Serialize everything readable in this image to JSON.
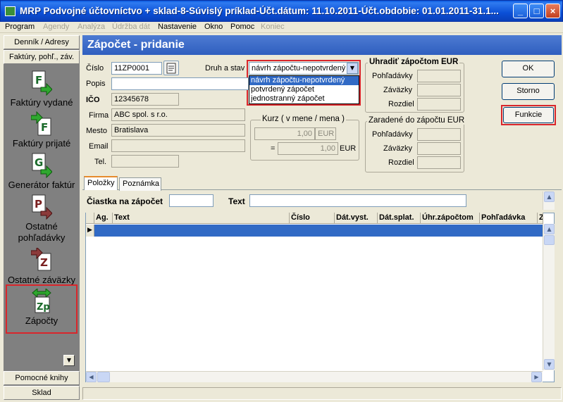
{
  "window": {
    "title": "MRP Podvojné účtovníctvo + sklad-8-Súvislý príklad-Účt.dátum: 11.10.2011-Účt.obdobie: 01.01.2011-31.1..."
  },
  "menu": [
    "Program",
    "Agendy",
    "Analýza",
    "Údržba dát",
    "Nastavenie",
    "Okno",
    "Pomoc",
    "Koniec"
  ],
  "sidebar": {
    "top_headers": [
      "Denník / Adresy",
      "Faktúry, pohľ., záv."
    ],
    "items": [
      {
        "label": "Faktúry vydané",
        "icon": "invoice-issued-icon"
      },
      {
        "label": "Faktúry prijaté",
        "icon": "invoice-received-icon"
      },
      {
        "label": "Generátor faktúr",
        "icon": "invoice-generator-icon"
      },
      {
        "label": "Ostatné pohľadávky",
        "icon": "receivables-icon"
      },
      {
        "label": "Ostatné záväzky",
        "icon": "liabilities-icon"
      },
      {
        "label": "Zápočty",
        "icon": "offset-icon"
      }
    ],
    "bottom_headers": [
      "Pomocné knihy",
      "Sklad"
    ]
  },
  "form": {
    "title": "Zápočet - pridanie",
    "cislo_label": "Číslo",
    "cislo_value": "11ZP0001",
    "druh_label": "Druh a stav",
    "druh_selected": "návrh zápočtu-nepotvrdený",
    "druh_options": [
      "návrh zápočtu-nepotvrdený",
      "potvrdený zápočet",
      "jednostranný zápočet"
    ],
    "popis_label": "Popis",
    "ico_label": "IČO",
    "ico_value": "12345678",
    "firma_label": "Firma",
    "firma_value": "ABC spol. s r.o.",
    "mesto_label": "Mesto",
    "mesto_value": "Bratislava",
    "email_label": "Email",
    "tel_label": "Tel.",
    "kurz_title": "Kurz ( v mene / mena )",
    "kurz_value": "1,00",
    "kurz_currency": "EUR",
    "kurz_eq": "=",
    "kurz_result": "1,00",
    "kurz_result_currency": "EUR",
    "uhradit_title": "Uhradiť zápočtom EUR",
    "zaradene_title": "Zaradené do zápočtu EUR",
    "pohladavky_label": "Pohľadávky",
    "zavazky_label": "Záväzky",
    "rozdiel_label": "Rozdiel"
  },
  "buttons": {
    "ok": "OK",
    "storno": "Storno",
    "funkcie": "Funkcie"
  },
  "tabs": [
    "Položky",
    "Poznámka"
  ],
  "filter": {
    "ciastka_label": "Čiastka na zápočet",
    "text_label": "Text"
  },
  "grid": {
    "columns": [
      "Ag.",
      "Text",
      "Číslo",
      "Dát.vyst.",
      "Dát.splat.",
      "Úhr.zápočtom",
      "Pohľadávka",
      "Z"
    ]
  },
  "colors": {
    "highlight": "#d9262b",
    "title_blue": "#0b4fd6",
    "selected_row": "#316ac5"
  }
}
